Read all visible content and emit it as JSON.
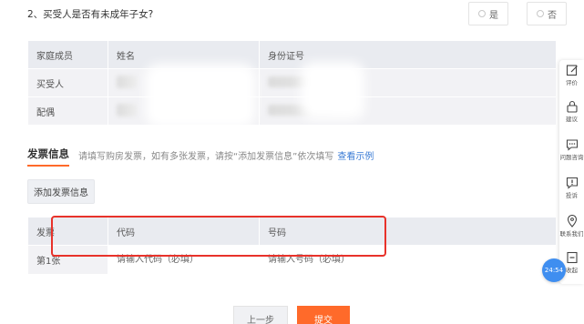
{
  "question": {
    "text": "2、买受人是否有未成年子女?",
    "yes_label": "是",
    "no_label": "否"
  },
  "family_table": {
    "headers": [
      "家庭成员",
      "姓名",
      "身份证号"
    ],
    "rows": [
      {
        "member": "买受人"
      },
      {
        "member": "配偶"
      }
    ]
  },
  "invoice_section": {
    "title": "发票信息",
    "hint": "请填写购房发票，如有多张发票，请按“添加发票信息”依次填写",
    "link": "查看示例",
    "add_button": "添加发票信息"
  },
  "invoice_table": {
    "headers": [
      "发票",
      "代码",
      "号码"
    ],
    "rows": [
      {
        "label": "第1张",
        "code_placeholder": "请输入代码（必填）",
        "number_placeholder": "请输入号码（必填）"
      }
    ]
  },
  "footer": {
    "prev_label": "上一步",
    "submit_label": "提交"
  },
  "sidebar": {
    "items": [
      "评价",
      "建议",
      "问题咨询",
      "投诉",
      "联系我们",
      "收起"
    ]
  },
  "timer": "24:54",
  "colors": {
    "accent": "#ff6a2a",
    "link": "#3a7bd5",
    "highlight_box": "#e8322a",
    "timer_bg": "#3f8ef0"
  }
}
